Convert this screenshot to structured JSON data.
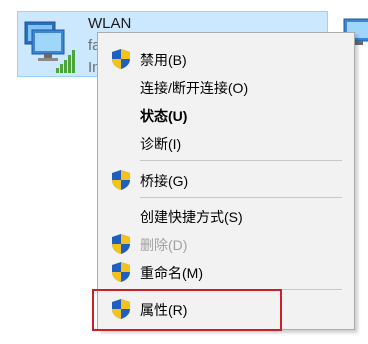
{
  "adapter": {
    "name": "WLAN",
    "line1": "fa",
    "line2": "In"
  },
  "menu": {
    "items": [
      {
        "label": "禁用(B)",
        "icon": "uac-shield-icon",
        "bold": false,
        "disabled": false
      },
      {
        "label": "连接/断开连接(O)",
        "icon": null,
        "bold": false,
        "disabled": false
      },
      {
        "label": "状态(U)",
        "icon": null,
        "bold": true,
        "disabled": false
      },
      {
        "label": "诊断(I)",
        "icon": null,
        "bold": false,
        "disabled": false
      },
      {
        "label": "桥接(G)",
        "icon": "uac-shield-icon",
        "bold": false,
        "disabled": false
      },
      {
        "label": "创建快捷方式(S)",
        "icon": null,
        "bold": false,
        "disabled": false
      },
      {
        "label": "删除(D)",
        "icon": "uac-shield-icon",
        "bold": false,
        "disabled": true
      },
      {
        "label": "重命名(M)",
        "icon": "uac-shield-icon",
        "bold": false,
        "disabled": false
      },
      {
        "label": "属性(R)",
        "icon": "uac-shield-icon",
        "bold": false,
        "disabled": false
      }
    ]
  },
  "colors": {
    "selection_bg": "#cce8ff",
    "menu_bg": "#f2f2f2",
    "highlight_border": "#c9202a",
    "disabled_text": "#a0a0a0"
  }
}
